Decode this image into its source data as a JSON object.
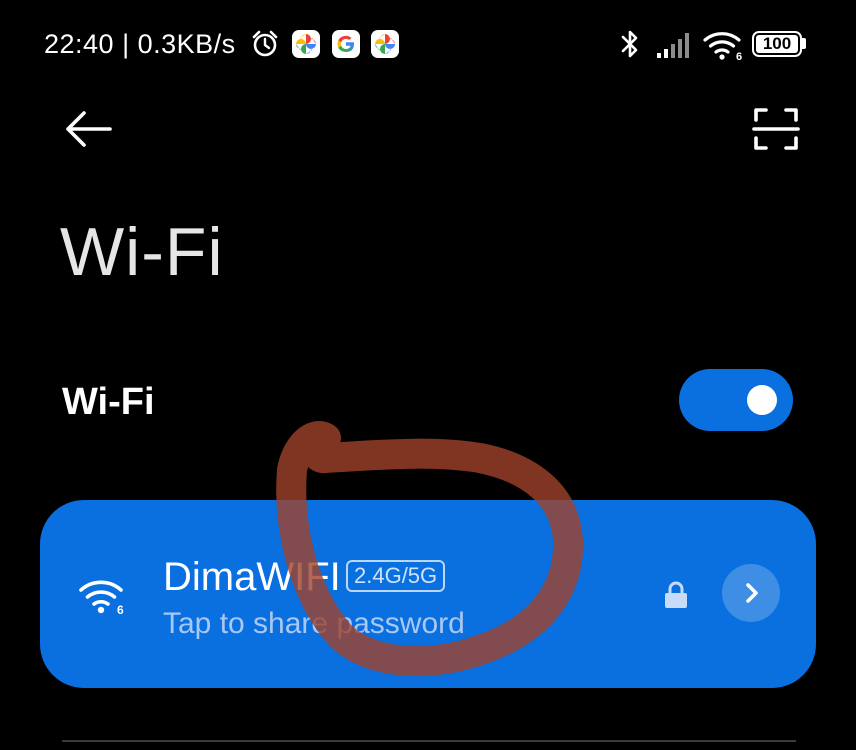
{
  "status_bar": {
    "time_speed": "22:40 | 0.3KB/s",
    "battery_level": "100",
    "battery_fraction": 1.0,
    "icons": [
      "alarm-icon",
      "google-photos-icon",
      "google-icon",
      "google-photos-icon",
      "bluetooth-icon",
      "signal-icon",
      "wifi-icon",
      "battery-icon"
    ],
    "wifi_standard": "6"
  },
  "header": {
    "back_icon": "arrow-left-icon",
    "scan_icon": "qr-scan-icon"
  },
  "page": {
    "title": "Wi-Fi"
  },
  "wifi_toggle": {
    "label": "Wi-Fi",
    "enabled": true
  },
  "connected_network": {
    "ssid": "DimaWIFI",
    "band": "2.4G/5G",
    "subtitle": "Tap to share password",
    "wifi_standard": "6",
    "secured": true
  },
  "colors": {
    "background": "#000000",
    "accent": "#0a6fdf",
    "card": "#0a6fdf",
    "subtitle": "#a7c8f4",
    "annotation": "#a0422b"
  }
}
